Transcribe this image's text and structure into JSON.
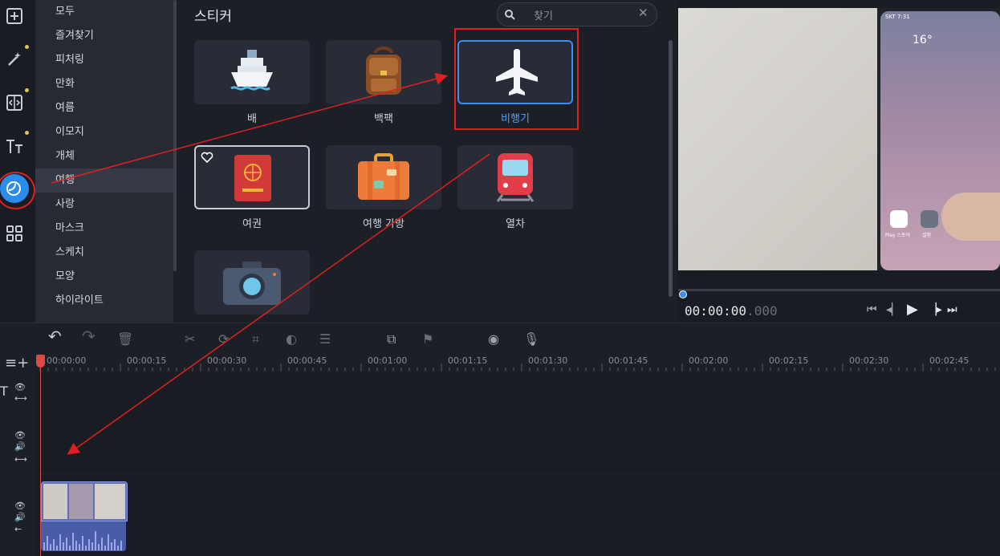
{
  "categories": [
    "모두",
    "즐겨찾기",
    "피처링",
    "만화",
    "여름",
    "이모지",
    "개체",
    "여행",
    "사랑",
    "마스크",
    "스케치",
    "모양",
    "하이라이트"
  ],
  "selected_category": "여행",
  "panel": {
    "title": "스티커",
    "search_placeholder": "찾기"
  },
  "stickers": [
    {
      "label": "배",
      "icon": "ship-icon"
    },
    {
      "label": "백팩",
      "icon": "backpack-icon"
    },
    {
      "label": "비행기",
      "icon": "airplane-icon",
      "selected": true
    },
    {
      "label": "여권",
      "icon": "passport-icon",
      "favorite_toggle": true
    },
    {
      "label": "여행 가방",
      "icon": "suitcase-icon"
    },
    {
      "label": "열차",
      "icon": "train-icon"
    },
    {
      "label": "",
      "icon": "camera-icon"
    }
  ],
  "player": {
    "time": "00:00:00",
    "ms": ".000"
  },
  "phone": {
    "status": "SKT 7:31",
    "temp": "16°",
    "apps": [
      "Play 스토어",
      "설정"
    ]
  },
  "ruler_ticks": [
    "00:00:00",
    "00:00:15",
    "00:00:30",
    "00:00:45",
    "00:01:00",
    "00:01:15",
    "00:01:30",
    "00:01:45",
    "00:02:00",
    "00:02:15",
    "00:02:30",
    "00:02:45"
  ],
  "colors": {
    "accent": "#3b8ff0",
    "annotation": "#e02020",
    "dot": "#e8c24a"
  }
}
